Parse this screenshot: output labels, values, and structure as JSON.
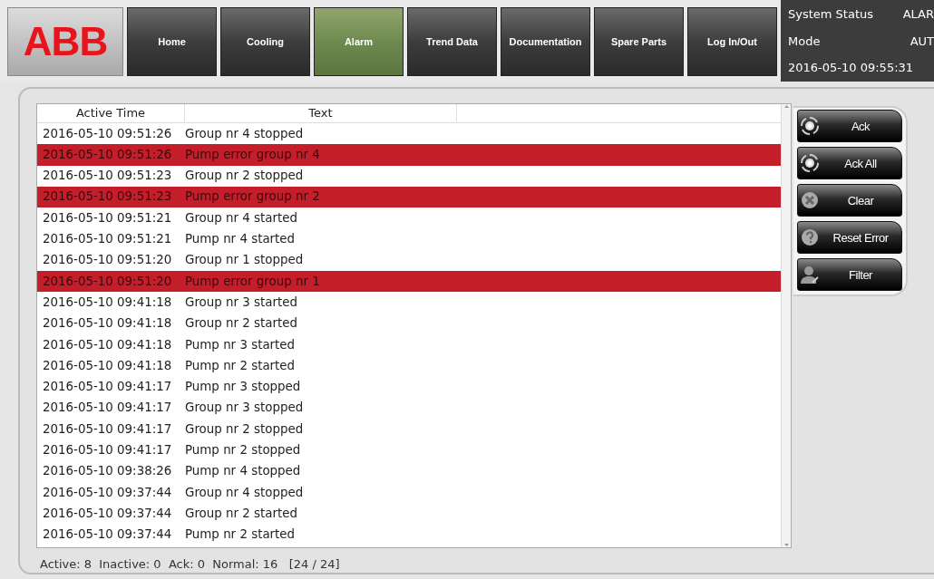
{
  "logo": {
    "text": "ABB"
  },
  "nav": [
    {
      "label": "Home",
      "selected": false
    },
    {
      "label": "Cooling",
      "selected": false
    },
    {
      "label": "Alarm",
      "selected": true
    },
    {
      "label": "Trend Data",
      "selected": false
    },
    {
      "label": "Documentation",
      "selected": false
    },
    {
      "label": "Spare Parts",
      "selected": false
    },
    {
      "label": "Log In/Out",
      "selected": false
    }
  ],
  "status": [
    {
      "label": "System Status",
      "value": "ALAR"
    },
    {
      "label": "Mode",
      "value": "AUT"
    },
    {
      "label": "2016-05-10 09:55:31"
    }
  ],
  "table": {
    "columns": [
      "Active Time",
      "Text"
    ],
    "rows": [
      {
        "time": "2016-05-10 09:51:26",
        "text": "Group nr 4 stopped",
        "alarm": false
      },
      {
        "time": "2016-05-10 09:51:26",
        "text": "Pump error group nr 4",
        "alarm": true
      },
      {
        "time": "2016-05-10 09:51:23",
        "text": "Group nr 2 stopped",
        "alarm": false
      },
      {
        "time": "2016-05-10 09:51:23",
        "text": "Pump error group nr 2",
        "alarm": true
      },
      {
        "time": "2016-05-10 09:51:21",
        "text": "Group nr 4 started",
        "alarm": false
      },
      {
        "time": "2016-05-10 09:51:21",
        "text": "Pump nr 4 started",
        "alarm": false
      },
      {
        "time": "2016-05-10 09:51:20",
        "text": "Group nr 1 stopped",
        "alarm": false
      },
      {
        "time": "2016-05-10 09:51:20",
        "text": "Pump error group nr 1",
        "alarm": true
      },
      {
        "time": "2016-05-10 09:41:18",
        "text": "Group nr 3 started",
        "alarm": false
      },
      {
        "time": "2016-05-10 09:41:18",
        "text": "Group nr 2 started",
        "alarm": false
      },
      {
        "time": "2016-05-10 09:41:18",
        "text": "Pump nr 3 started",
        "alarm": false
      },
      {
        "time": "2016-05-10 09:41:18",
        "text": "Pump nr 2 started",
        "alarm": false
      },
      {
        "time": "2016-05-10 09:41:17",
        "text": "Pump nr 3 stopped",
        "alarm": false
      },
      {
        "time": "2016-05-10 09:41:17",
        "text": "Group nr 3 stopped",
        "alarm": false
      },
      {
        "time": "2016-05-10 09:41:17",
        "text": "Group nr 2 stopped",
        "alarm": false
      },
      {
        "time": "2016-05-10 09:41:17",
        "text": "Pump nr 2 stopped",
        "alarm": false
      },
      {
        "time": "2016-05-10 09:38:26",
        "text": "Pump nr 4 stopped",
        "alarm": false
      },
      {
        "time": "2016-05-10 09:37:44",
        "text": "Group nr 4 stopped",
        "alarm": false
      },
      {
        "time": "2016-05-10 09:37:44",
        "text": "Group nr 2 started",
        "alarm": false
      },
      {
        "time": "2016-05-10 09:37:44",
        "text": "Pump nr 2 started",
        "alarm": false
      }
    ]
  },
  "buttons": [
    {
      "label": "Ack",
      "kind": "ack"
    },
    {
      "label": "Ack All",
      "kind": "ack"
    },
    {
      "label": "Clear",
      "kind": "clear"
    },
    {
      "label": "Reset Error",
      "kind": "reset"
    },
    {
      "label": "Filter",
      "kind": "filter"
    }
  ],
  "status_bar": "Active: 8  Inactive: 0  Ack: 0  Normal: 16   [24 / 24]"
}
